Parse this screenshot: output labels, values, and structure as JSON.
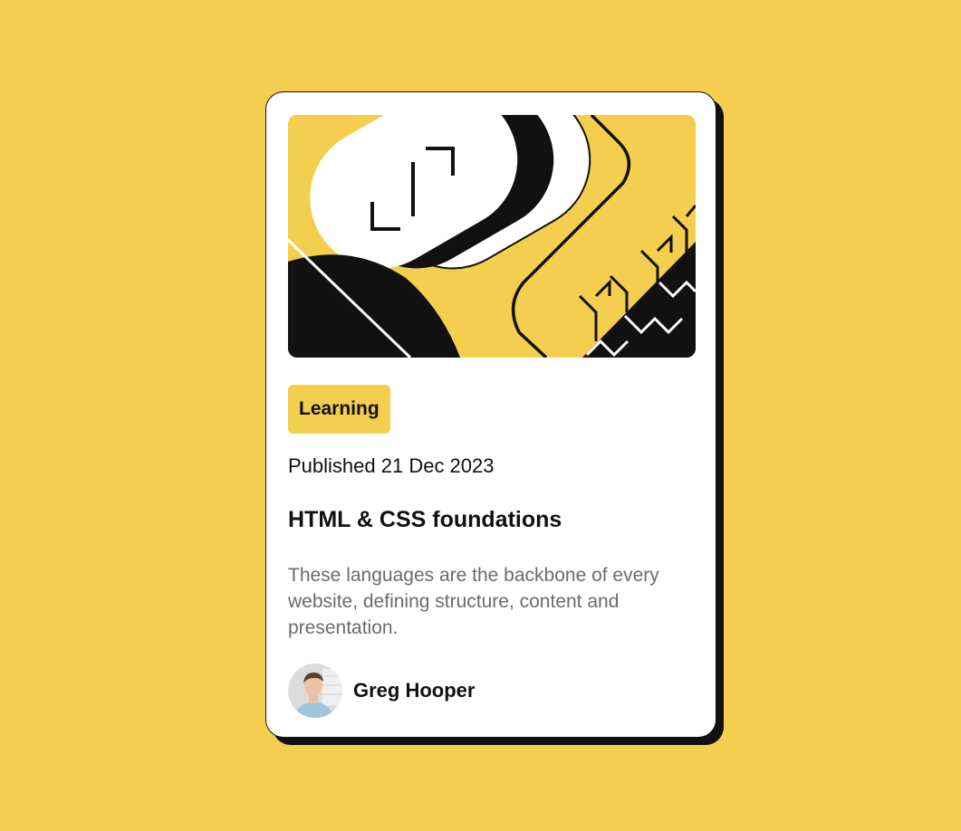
{
  "card": {
    "category": "Learning",
    "published": "Published 21 Dec 2023",
    "title": "HTML & CSS foundations",
    "description": "These languages are the backbone of every website, defining structure, content and presentation.",
    "author": {
      "name": "Greg Hooper",
      "avatar_icon": "avatar-photo"
    },
    "hero_image_icon": "abstract-illustration"
  },
  "colors": {
    "background": "#F4CE4E",
    "card": "#FFFFFF",
    "ink": "#111111",
    "muted_text": "#6B6B6B"
  }
}
